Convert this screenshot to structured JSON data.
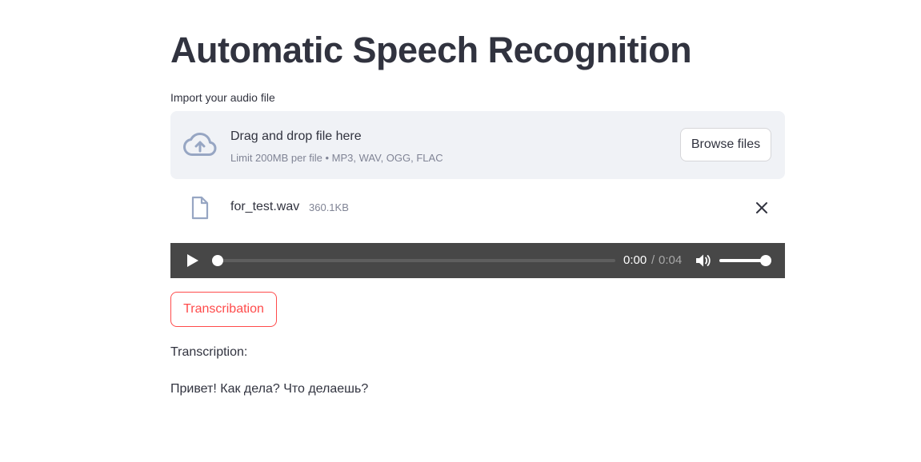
{
  "header": {
    "title": "Automatic Speech Recognition"
  },
  "uploader": {
    "label": "Import your audio file",
    "drop_title": "Drag and drop file here",
    "drop_limit": "Limit 200MB per file • MP3, WAV, OGG, FLAC",
    "browse_label": "Browse files",
    "icon": "cloud-upload-icon"
  },
  "uploaded_file": {
    "name": "for_test.wav",
    "size": "360.1KB",
    "icon": "file-icon",
    "remove_icon": "close-icon"
  },
  "audio_player": {
    "current_time": "0:00",
    "separator": "/",
    "total_time": "0:04",
    "progress": 0.0,
    "volume": 1.0
  },
  "actions": {
    "transcribe_label": "Transcribation"
  },
  "result": {
    "label": "Transcription:",
    "text": "Привет! Как дела? Что делаешь?"
  },
  "colors": {
    "accent": "#ff4b4b",
    "text": "#31333f",
    "muted": "#808495",
    "dropzone_bg": "#f0f2f6",
    "player_bg": "#474747"
  }
}
